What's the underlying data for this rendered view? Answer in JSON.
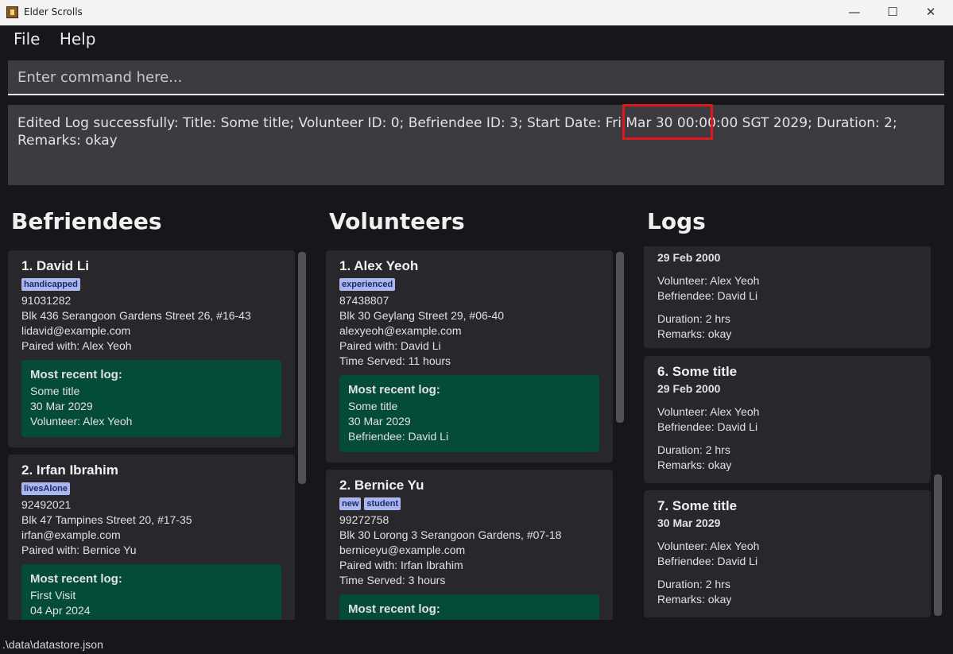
{
  "window": {
    "title": "Elder Scrolls",
    "controls": [
      "—",
      "☐",
      "✕"
    ]
  },
  "menu": [
    "File",
    "Help"
  ],
  "command": {
    "placeholder": "Enter command here..."
  },
  "result": {
    "text": "Edited Log successfully: Title: Some title; Volunteer ID: 0; Befriendee ID: 3; Start Date: Fri Mar 30 00:00:00 SGT 2029; Duration: 2; Remarks: okay"
  },
  "befriendees": {
    "title": "Befriendees",
    "items": [
      {
        "name": "1.  David Li",
        "tags": [
          "handicapped"
        ],
        "phone": "91031282",
        "address": "Blk 436 Serangoon Gardens Street 26, #16-43",
        "email": "lidavid@example.com",
        "paired": "Paired with: Alex Yeoh",
        "recent": {
          "head": "Most recent log:",
          "title": "Some title",
          "date": "30 Mar 2029",
          "who": "Volunteer: Alex Yeoh"
        }
      },
      {
        "name": "2.  Irfan Ibrahim",
        "tags": [
          "livesAlone"
        ],
        "phone": "92492021",
        "address": "Blk 47 Tampines Street 20, #17-35",
        "email": "irfan@example.com",
        "paired": "Paired with: Bernice Yu",
        "recent": {
          "head": "Most recent log:",
          "title": "First Visit",
          "date": "04 Apr 2024"
        }
      }
    ]
  },
  "volunteers": {
    "title": "Volunteers",
    "items": [
      {
        "name": "1.  Alex Yeoh",
        "tags": [
          "experienced"
        ],
        "phone": "87438807",
        "address": "Blk 30 Geylang Street 29, #06-40",
        "email": "alexyeoh@example.com",
        "paired": "Paired with: David Li",
        "served": "Time Served: 11 hours",
        "recent": {
          "head": "Most recent log:",
          "title": "Some title",
          "date": "30 Mar 2029",
          "who": "Befriendee: David Li"
        }
      },
      {
        "name": "2.  Bernice Yu",
        "tags": [
          "new",
          "student"
        ],
        "phone": "99272758",
        "address": "Blk 30 Lorong 3 Serangoon Gardens, #07-18",
        "email": "berniceyu@example.com",
        "paired": "Paired with: Irfan Ibrahim",
        "served": "Time Served: 3 hours",
        "recent": {
          "head": "Most recent log:"
        }
      }
    ]
  },
  "logs": {
    "title": "Logs",
    "items": [
      {
        "title": "",
        "date": "29 Feb 2000",
        "volunteer": "Volunteer: Alex Yeoh",
        "befriendee": "Befriendee: David Li",
        "duration": "Duration: 2 hrs",
        "remarks": "Remarks: okay"
      },
      {
        "title": "6.  Some title",
        "date": "29 Feb 2000",
        "volunteer": "Volunteer: Alex Yeoh",
        "befriendee": "Befriendee: David Li",
        "duration": "Duration: 2 hrs",
        "remarks": "Remarks: okay"
      },
      {
        "title": "7.  Some title",
        "date": "30 Mar 2029",
        "volunteer": "Volunteer: Alex Yeoh",
        "befriendee": "Befriendee: David Li",
        "duration": "Duration: 2 hrs",
        "remarks": "Remarks: okay"
      }
    ]
  },
  "status": {
    "path": ".\\data\\datastore.json"
  }
}
